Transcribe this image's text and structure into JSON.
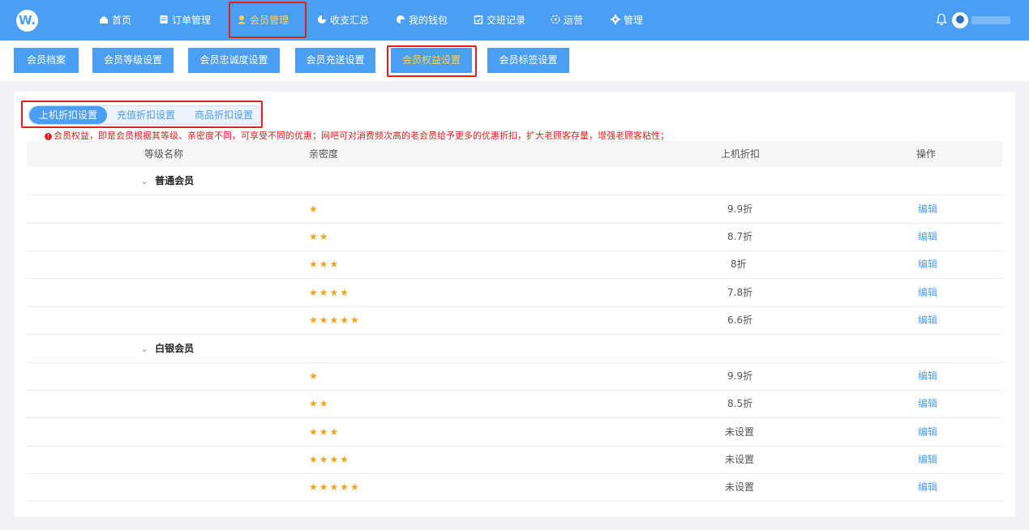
{
  "app": {
    "logo_text": "W."
  },
  "nav": {
    "items": [
      {
        "label": "首页",
        "icon": "home-icon"
      },
      {
        "label": "订单管理",
        "icon": "order-icon"
      },
      {
        "label": "会员管理",
        "icon": "member-icon",
        "active": true
      },
      {
        "label": "收支汇总",
        "icon": "pie-chart-icon"
      },
      {
        "label": "我的钱包",
        "icon": "wallet-icon"
      },
      {
        "label": "交班记录",
        "icon": "shift-icon"
      },
      {
        "label": "运营",
        "icon": "operation-icon"
      },
      {
        "label": "管理",
        "icon": "gear-icon"
      }
    ]
  },
  "subnav": {
    "items": [
      {
        "label": "会员档案"
      },
      {
        "label": "会员等级设置"
      },
      {
        "label": "会员忠诚度设置"
      },
      {
        "label": "会员充送设置"
      },
      {
        "label": "会员权益设置",
        "active": true
      },
      {
        "label": "会员标签设置"
      }
    ]
  },
  "tabs": {
    "items": [
      {
        "label": "上机折扣设置",
        "active": true
      },
      {
        "label": "充值折扣设置"
      },
      {
        "label": "商品折扣设置"
      }
    ]
  },
  "notice": {
    "icon": "!",
    "text": "会员权益，即是会员根据其等级、亲密度不同，可享受不同的优惠；网吧可对消费频次高的老会员给予更多的优惠折扣，扩大老顾客存量，增强老顾客粘性；"
  },
  "table": {
    "headers": {
      "level_name": "等级名称",
      "intimacy": "亲密度",
      "discount": "上机折扣",
      "action": "操作"
    },
    "groups": [
      {
        "name": "普通会员",
        "chevron": "⌄",
        "rows": [
          {
            "stars": "★",
            "discount": "9.9折",
            "action": "编辑"
          },
          {
            "stars": "★★",
            "discount": "8.7折",
            "action": "编辑"
          },
          {
            "stars": "★★★",
            "discount": "8折",
            "action": "编辑"
          },
          {
            "stars": "★★★★",
            "discount": "7.8折",
            "action": "编辑"
          },
          {
            "stars": "★★★★★",
            "discount": "6.6折",
            "action": "编辑"
          }
        ]
      },
      {
        "name": "白银会员",
        "chevron": "⌄",
        "rows": [
          {
            "stars": "★",
            "discount": "9.9折",
            "action": "编辑"
          },
          {
            "stars": "★★",
            "discount": "8.5折",
            "action": "编辑"
          },
          {
            "stars": "★★★",
            "discount": "未设置",
            "action": "编辑"
          },
          {
            "stars": "★★★★",
            "discount": "未设置",
            "action": "编辑"
          },
          {
            "stars": "★★★★★",
            "discount": "未设置",
            "action": "编辑"
          }
        ]
      }
    ]
  },
  "colors": {
    "primary": "#4a9ef3",
    "active_text": "#ffd24a",
    "highlight": "#e02020",
    "star": "#f3a21c"
  }
}
